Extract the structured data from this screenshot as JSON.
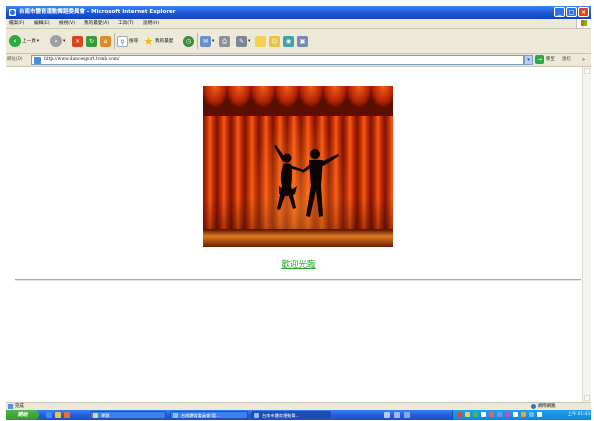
{
  "window": {
    "title": "台南市體育運動舞蹈委員會 - Microsoft Internet Explorer",
    "buttons": [
      "minimize",
      "maximize",
      "close"
    ]
  },
  "menu": {
    "items": [
      "檔案(F)",
      "編輯(E)",
      "檢視(V)",
      "我的最愛(A)",
      "工具(T)",
      "說明(H)"
    ]
  },
  "toolbar": {
    "back_label": "上一頁",
    "search_label": "搜尋",
    "favorites_label": "我的最愛",
    "icons": [
      "back-icon",
      "forward-icon",
      "stop-icon",
      "refresh-icon",
      "home-icon",
      "search-icon",
      "favorites-icon",
      "history-icon",
      "mail-icon",
      "print-icon",
      "edit-icon",
      "folder-icon",
      "messenger-icon",
      "research-icon"
    ]
  },
  "address": {
    "label": "網址(D)",
    "url": "http://www.dancesport.tcmb.com/",
    "go_label": "移至",
    "links_label": "連結"
  },
  "page": {
    "welcome_link": "歡迎光臨"
  },
  "status": {
    "left_text": "完成",
    "zone_text": "網際網路"
  },
  "taskbar": {
    "start_label": "開始",
    "tasks": [
      "專題",
      "台南體育委員會(暫...",
      "台南市體育運動舞..."
    ],
    "clock": "上午 01:43"
  },
  "colors": {
    "title_bar": "#1b56d8",
    "link": "#22a62a",
    "chrome": "#ece9d8"
  }
}
